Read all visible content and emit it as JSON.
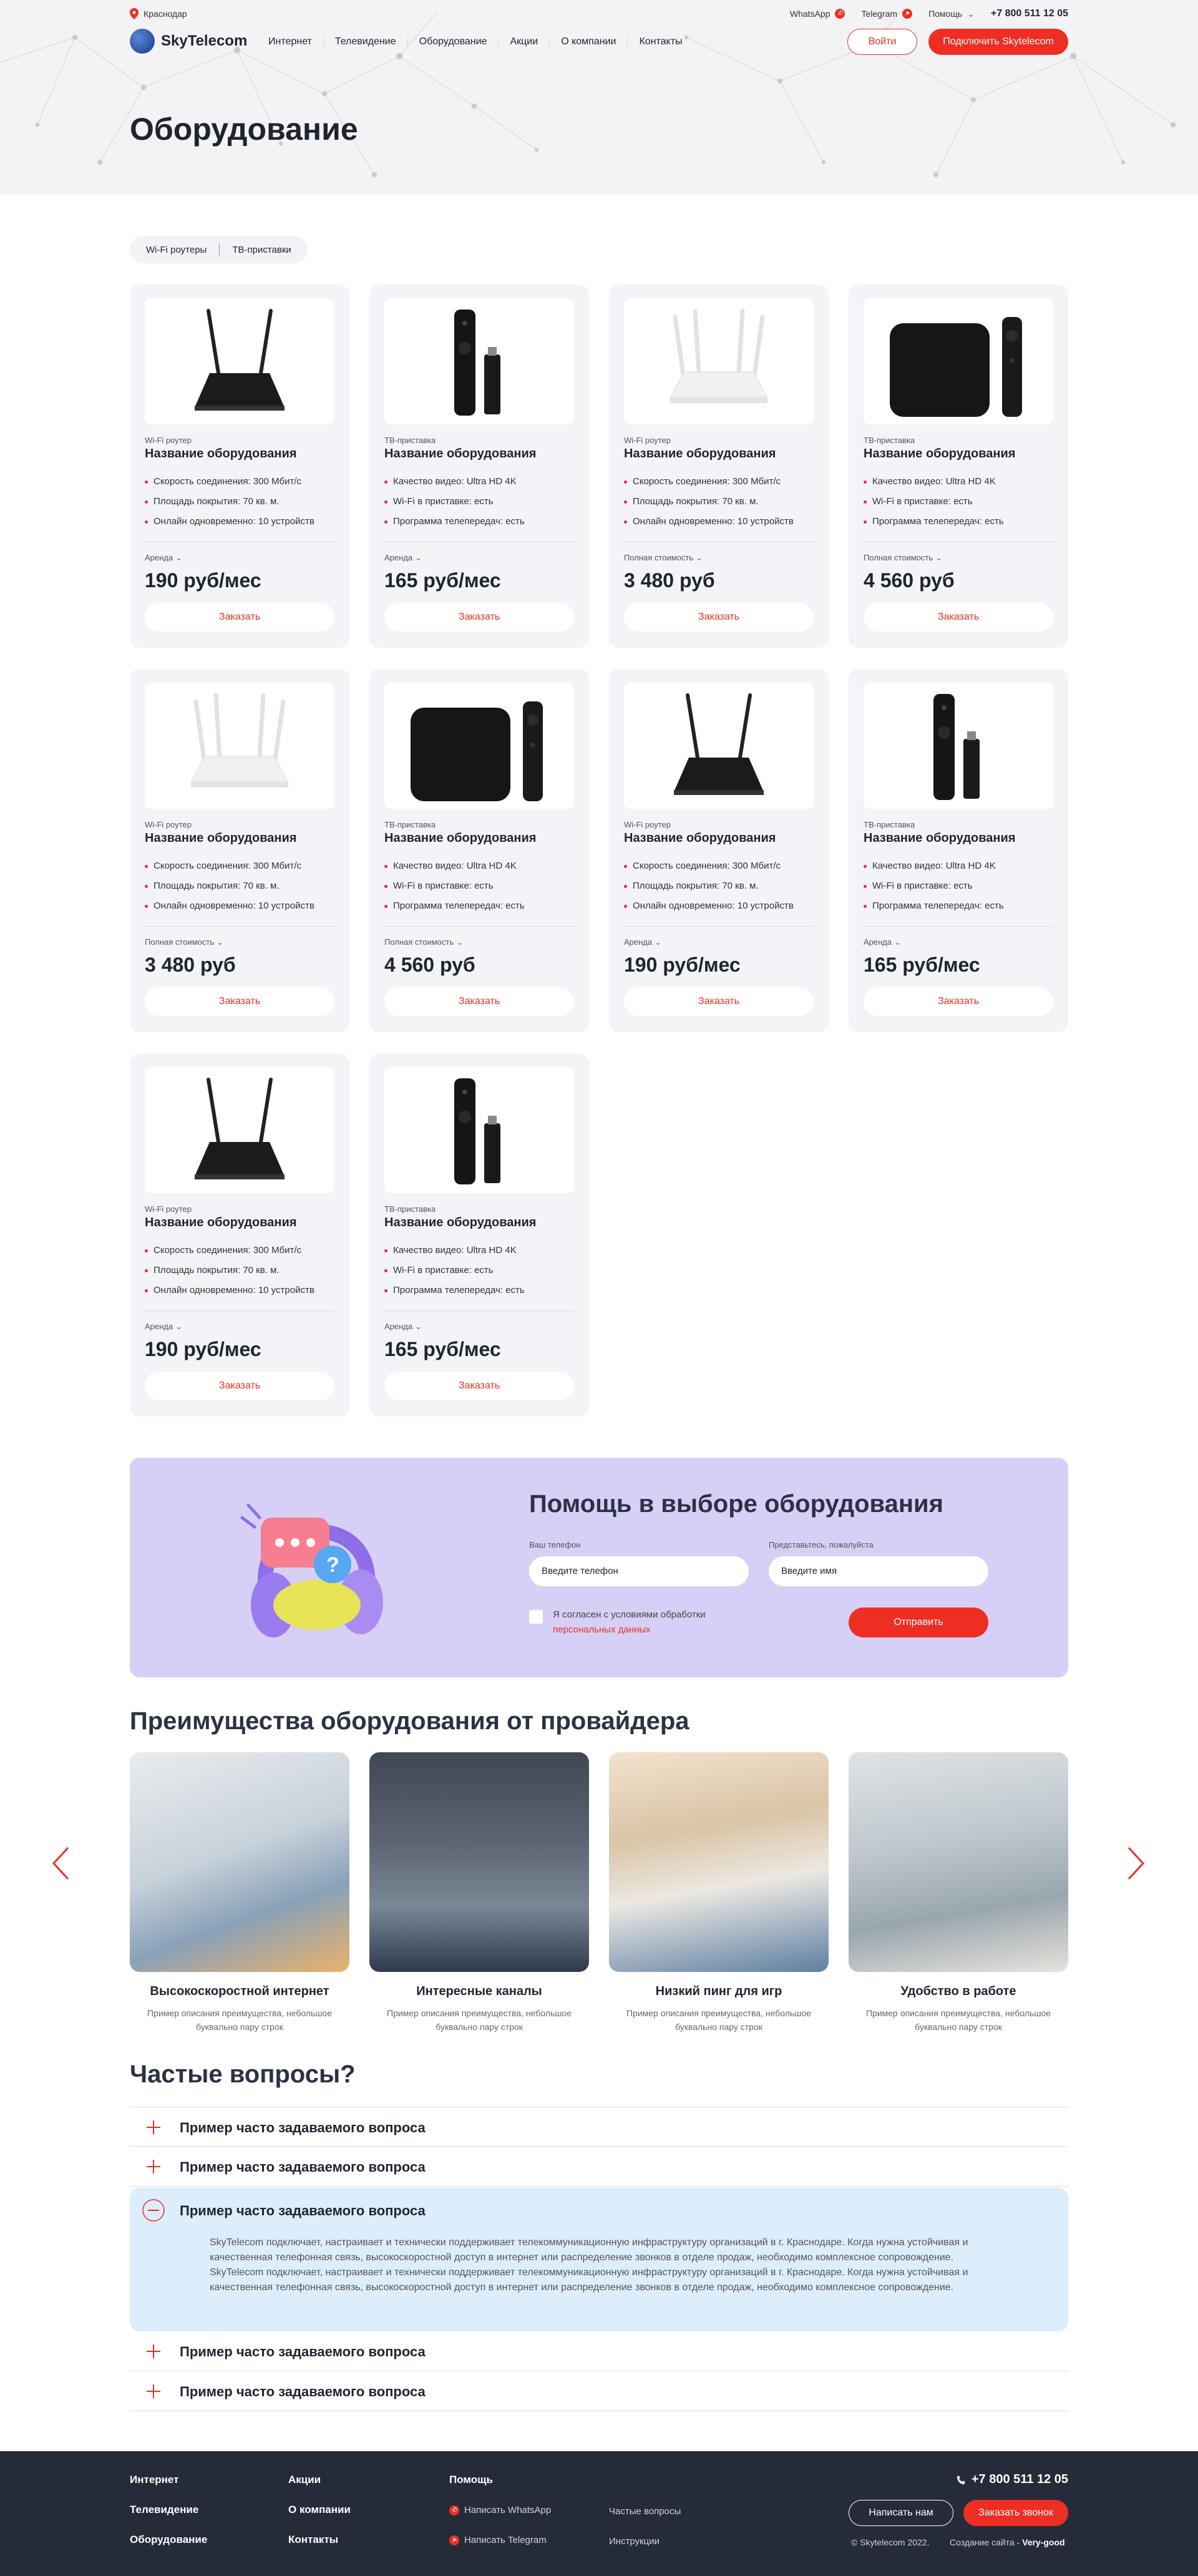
{
  "header": {
    "city": "Краснодар",
    "whatsapp": "WhatsApp",
    "telegram": "Telegram",
    "help": "Помощь",
    "phone": "+7 800 511 12 05",
    "logo": "SkyTelecom",
    "nav": [
      "Интернет",
      "Телевидение",
      "Оборудование",
      "Акции",
      "О компании",
      "Контакты"
    ],
    "login": "Войти",
    "connect": "Подключить Skytelecom"
  },
  "page_title": "Оборудование",
  "filters": [
    "Wi-Fi роутеры",
    "ТВ-приставки"
  ],
  "products": [
    {
      "kind": "router-black",
      "type": "Wi-Fi роутер",
      "name": "Название оборудования",
      "specs": [
        [
          "Скорость соединения: ",
          "300 Мбит/с"
        ],
        [
          "Площадь покрытия: ",
          "70 кв. м."
        ],
        [
          "Онлайн одновременно: ",
          "10 устройств"
        ]
      ],
      "price_type": "Аренда",
      "price": "190 руб/мес",
      "order": "Заказать"
    },
    {
      "kind": "stick",
      "type": "ТВ-приставка",
      "name": "Название оборудования",
      "specs": [
        [
          "Качество видео: ",
          "Ultra HD 4K"
        ],
        [
          "Wi-Fi в приставке: ",
          "есть"
        ],
        [
          "Программа телепередач: ",
          "есть"
        ]
      ],
      "price_type": "Аренда",
      "price": "165 руб/мес",
      "order": "Заказать"
    },
    {
      "kind": "router-white",
      "type": "Wi-Fi роутер",
      "name": "Название оборудования",
      "specs": [
        [
          "Скорость соединения: ",
          "300 Мбит/с"
        ],
        [
          "Площадь покрытия: ",
          "70 кв. м."
        ],
        [
          "Онлайн одновременно: ",
          "10 устройств"
        ]
      ],
      "price_type": "Полная стоимость",
      "price": "3 480 руб",
      "order": "Заказать"
    },
    {
      "kind": "box",
      "type": "ТВ-приставка",
      "name": "Название оборудования",
      "specs": [
        [
          "Качество видео: ",
          "Ultra HD 4K"
        ],
        [
          "Wi-Fi в приставке: ",
          "есть"
        ],
        [
          "Программа телепередач: ",
          "есть"
        ]
      ],
      "price_type": "Полная стоимость",
      "price": "4 560 руб",
      "order": "Заказать"
    },
    {
      "kind": "router-white",
      "type": "Wi-Fi роутер",
      "name": "Название оборудования",
      "specs": [
        [
          "Скорость соединения: ",
          "300 Мбит/с"
        ],
        [
          "Площадь покрытия: ",
          "70 кв. м."
        ],
        [
          "Онлайн одновременно: ",
          "10 устройств"
        ]
      ],
      "price_type": "Полная стоимость",
      "price": "3 480 руб",
      "order": "Заказать"
    },
    {
      "kind": "box",
      "type": "ТВ-приставка",
      "name": "Название оборудования",
      "specs": [
        [
          "Качество видео: ",
          "Ultra HD 4K"
        ],
        [
          "Wi-Fi в приставке: ",
          "есть"
        ],
        [
          "Программа телепередач: ",
          "есть"
        ]
      ],
      "price_type": "Полная стоимость",
      "price": "4 560 руб",
      "order": "Заказать"
    },
    {
      "kind": "router-black",
      "type": "Wi-Fi роутер",
      "name": "Название оборудования",
      "specs": [
        [
          "Скорость соединения: ",
          "300 Мбит/с"
        ],
        [
          "Площадь покрытия: ",
          "70 кв. м."
        ],
        [
          "Онлайн одновременно: ",
          "10 устройств"
        ]
      ],
      "price_type": "Аренда",
      "price": "190 руб/мес",
      "order": "Заказать"
    },
    {
      "kind": "stick",
      "type": "ТВ-приставка",
      "name": "Название оборудования",
      "specs": [
        [
          "Качество видео: ",
          "Ultra HD 4K"
        ],
        [
          "Wi-Fi в приставке: ",
          "есть"
        ],
        [
          "Программа телепередач: ",
          "есть"
        ]
      ],
      "price_type": "Аренда",
      "price": "165 руб/мес",
      "order": "Заказать"
    },
    {
      "kind": "router-black",
      "type": "Wi-Fi роутер",
      "name": "Название оборудования",
      "specs": [
        [
          "Скорость соединения: ",
          "300 Мбит/с"
        ],
        [
          "Площадь покрытия: ",
          "70 кв. м."
        ],
        [
          "Онлайн одновременно: ",
          "10 устройств"
        ]
      ],
      "price_type": "Аренда",
      "price": "190 руб/мес",
      "order": "Заказать"
    },
    {
      "kind": "stick",
      "type": "ТВ-приставка",
      "name": "Название оборудования",
      "specs": [
        [
          "Качество видео: ",
          "Ultra HD 4K"
        ],
        [
          "Wi-Fi в приставке: ",
          "есть"
        ],
        [
          "Программа телепередач: ",
          "есть"
        ]
      ],
      "price_type": "Аренда",
      "price": "165 руб/мес",
      "order": "Заказать"
    }
  ],
  "help": {
    "title": "Помощь в выборе оборудования",
    "phone_label": "Ваш телефон",
    "phone_placeholder": "Введите телефон",
    "name_label": "Представьтесь, пожалуйста",
    "name_placeholder": "Введите имя",
    "agree_text": "Я согласен с условиями обработки",
    "agree_link": "персональных данных",
    "submit": "Отправить"
  },
  "advantages": {
    "title": "Преимущества оборудования от провайдера",
    "items": [
      {
        "title": "Высокоскоростной интернет",
        "desc": "Пример описания преимущества, небольшое буквально пару строк"
      },
      {
        "title": "Интересные каналы",
        "desc": "Пример описания преимущества, небольшое буквально пару строк"
      },
      {
        "title": "Низкий пинг для игр",
        "desc": "Пример описания преимущества, небольшое буквально пару строк"
      },
      {
        "title": "Удобство в работе",
        "desc": "Пример описания преимущества, небольшое буквально пару строк"
      }
    ]
  },
  "faq": {
    "title": "Частые вопросы?",
    "items": [
      "Пример часто задаваемого вопроса",
      "Пример часто задаваемого вопроса",
      "Пример часто задаваемого вопроса",
      "Пример часто задаваемого вопроса",
      "Пример часто задаваемого вопроса"
    ],
    "open_answer": "SkyTelecom подключает, настраивает и технически поддерживает телекоммуникационную инфраструктуру организаций в г. Краснодаре. Когда нужна устойчивая и качественная телефонная связь, высокоскоростной доступ в интернет или распределение звонков в отделе продаж, необходимо комплексное сопровождение. SkyTelecom подключает, настраивает и технически поддерживает телекоммуникационную инфраструктуру организаций в г. Краснодаре. Когда нужна устойчивая и качественная телефонная связь, высокоскоростной доступ в интернет или распределение звонков в отделе продаж, необходимо комплексное сопровождение."
  },
  "footer": {
    "col1": [
      "Интернет",
      "Телевидение",
      "Оборудование"
    ],
    "col2": [
      "Акции",
      "О компании",
      "Контакты"
    ],
    "col3_title": "Помощь",
    "whatsapp": "Написать WhatsApp",
    "telegram": "Написать Telegram",
    "faq": "Частые вопросы",
    "instructions": "Инструкции",
    "phone": "+7 800 511 12 05",
    "write": "Написать нам",
    "call": "Заказать звонок",
    "copyright": "© Skytelecom 2022.",
    "made_by_label": "Создание сайта -",
    "made_by": "Very-good"
  }
}
